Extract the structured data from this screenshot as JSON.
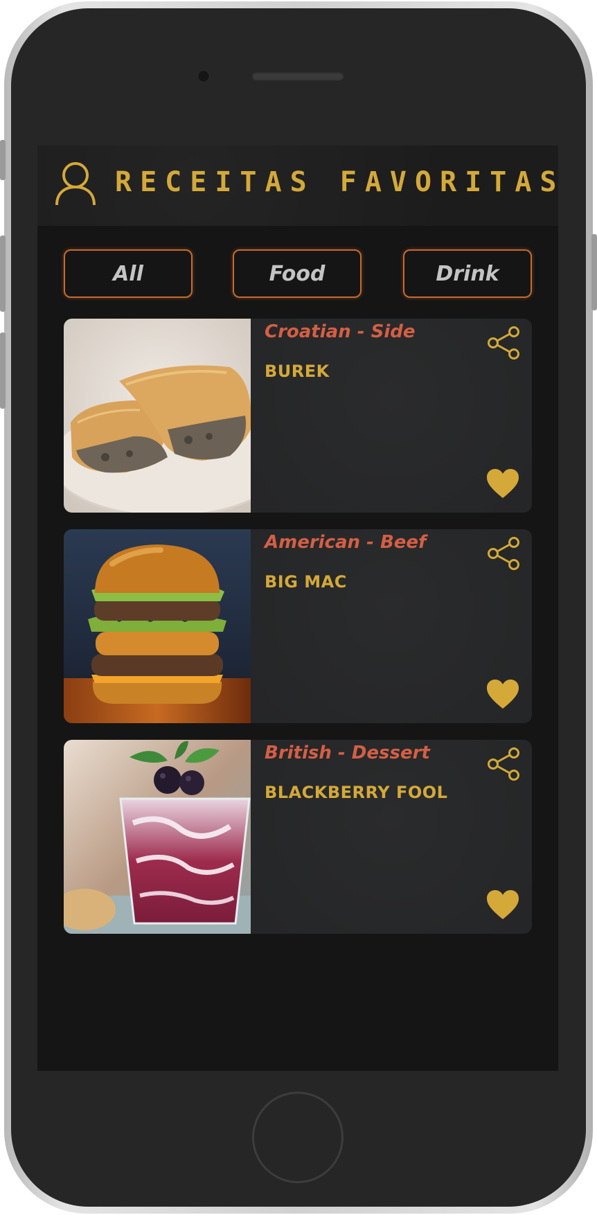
{
  "header": {
    "title": "RECEITAS FAVORITAS",
    "icon": "profile-icon"
  },
  "filters": [
    {
      "label": "All"
    },
    {
      "label": "Food"
    },
    {
      "label": "Drink"
    }
  ],
  "recipes": [
    {
      "category": "Croatian - Side",
      "name": "BUREK",
      "image": "burek-image"
    },
    {
      "category": "American - Beef",
      "name": "BIG MAC",
      "image": "big-mac-image"
    },
    {
      "category": "British - Dessert",
      "name": "BLACKBERRY FOOL",
      "image": "blackberry-fool-image"
    }
  ],
  "colors": {
    "accent_gold": "#d4a93a",
    "category_red": "#d45f45",
    "filter_border": "#c8692e",
    "background": "#151515",
    "card": "#262728"
  },
  "icons": {
    "share": "share-icon",
    "favorite": "heart-icon"
  }
}
